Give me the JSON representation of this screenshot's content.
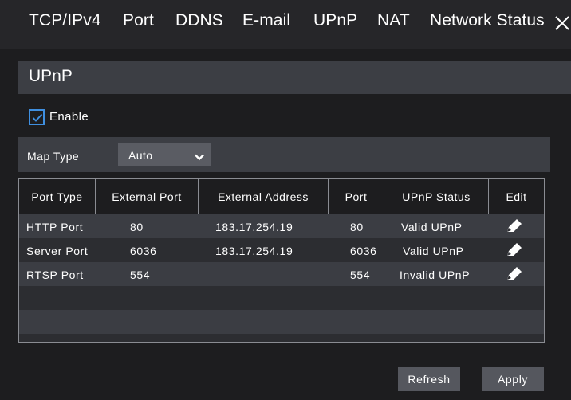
{
  "tabs": [
    {
      "label": "TCP/IPv4",
      "active": false
    },
    {
      "label": "Port",
      "active": false
    },
    {
      "label": "DDNS",
      "active": false
    },
    {
      "label": "E-mail",
      "active": false
    },
    {
      "label": "UPnP",
      "active": true
    },
    {
      "label": "NAT",
      "active": false
    },
    {
      "label": "Network Status",
      "active": false
    }
  ],
  "close_icon": "close-icon",
  "section": {
    "title": "UPnP"
  },
  "enable": {
    "label": "Enable",
    "checked": true
  },
  "map_type": {
    "label": "Map Type",
    "value": "Auto"
  },
  "table": {
    "headers": [
      "Port Type",
      "External Port",
      "External Address",
      "Port",
      "UPnP Status",
      "Edit"
    ],
    "rows": [
      {
        "port_type": "HTTP Port",
        "external_port": "80",
        "external_address": "183.17.254.19",
        "port": "80",
        "status": "Valid UPnP"
      },
      {
        "port_type": "Server Port",
        "external_port": "6036",
        "external_address": "183.17.254.19",
        "port": "6036",
        "status": "Valid UPnP"
      },
      {
        "port_type": "RTSP Port",
        "external_port": "554",
        "external_address": "",
        "port": "554",
        "status": "Invalid UPnP"
      }
    ],
    "edit_icon": "pencil-icon"
  },
  "buttons": {
    "refresh": "Refresh",
    "apply": "Apply"
  },
  "colors": {
    "background": "#1d1d1f",
    "panel": "#3c3e44",
    "checkbox_accent": "#3f8fe0",
    "button": "#55575e"
  }
}
